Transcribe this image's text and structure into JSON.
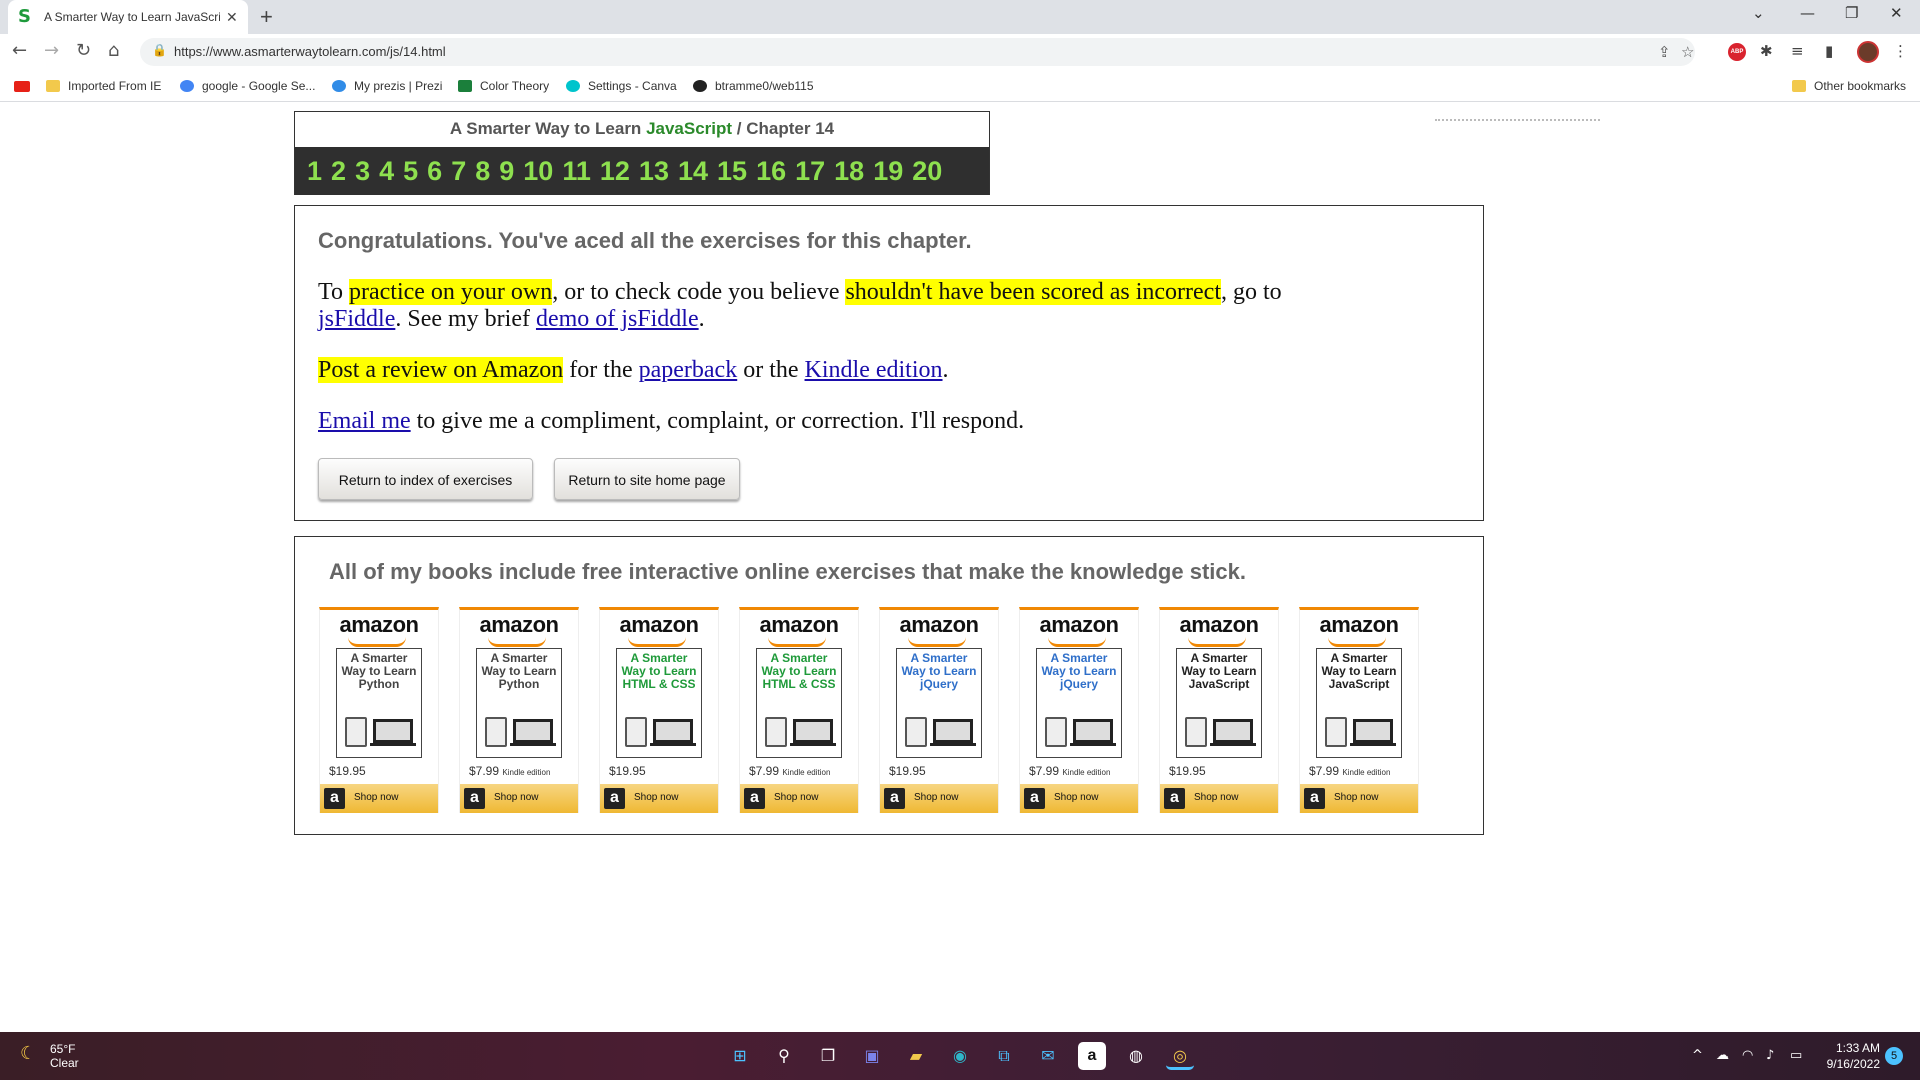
{
  "browser": {
    "tab_title": "A Smarter Way to Learn JavaScript",
    "tab_close": "✕",
    "new_tab": "+",
    "url": "https://www.asmarterwaytolearn.com/js/14.html",
    "bookmarks": [
      {
        "label": "Imported From IE",
        "icon_color": "#f2c94c"
      },
      {
        "label": "google - Google Se...",
        "icon_color": "#4285f4"
      },
      {
        "label": "My prezis | Prezi",
        "icon_color": "#318ce7"
      },
      {
        "label": "Color Theory",
        "icon_color": "#1b7f3b"
      },
      {
        "label": "Settings - Canva",
        "icon_color": "#00c4cc"
      },
      {
        "label": "btramme0/web115",
        "icon_color": "#222222"
      }
    ],
    "other_bookmarks": "Other bookmarks"
  },
  "chapter": {
    "title_prefix": "A Smarter Way to Learn",
    "title_js": "JavaScript",
    "title_sep": "/",
    "title_chapter": "Chapter 14",
    "numbers": [
      "1",
      "2",
      "3",
      "4",
      "5",
      "6",
      "7",
      "8",
      "9",
      "10",
      "11",
      "12",
      "13",
      "14",
      "15",
      "16",
      "17",
      "18",
      "19",
      "20"
    ]
  },
  "main": {
    "congrats": "Congratulations. You've aced all the exercises for this chapter.",
    "p1": {
      "t1": "To ",
      "h1": "practice on your own",
      "t2": ", or to check code you believe ",
      "h2": "shouldn't have been scored as incorrect",
      "t3": ", go to",
      "link1": "jsFiddle",
      "t4": ". See my brief ",
      "link2": "demo of jsFiddle",
      "t5": "."
    },
    "p2": {
      "h1": "Post a review on Amazon",
      "t1": " for the ",
      "link1": "paperback",
      "t2": " or the ",
      "link2": "Kindle edition",
      "t3": "."
    },
    "p3": {
      "link1": "Email me",
      "t1": " to give me a compliment, complaint, or correction. I'll respond."
    },
    "btn_index": "Return to index of exercises",
    "btn_home": "Return to site home page"
  },
  "books": {
    "heading": "All of my books include free interactive online exercises that make the knowledge stick.",
    "items": [
      {
        "logo": "amazon",
        "cover": "A Smarter Way to Learn Python",
        "cover_color": "#444444",
        "price": "$19.95",
        "kind": "",
        "shop": "Shop now"
      },
      {
        "logo": "amazon",
        "cover": "A Smarter Way to Learn Python",
        "cover_color": "#444444",
        "price": "$7.99",
        "kind": "Kindle edition",
        "shop": "Shop now"
      },
      {
        "logo": "amazon",
        "cover": "A Smarter Way to Learn HTML & CSS",
        "cover_color": "#1f9a3a",
        "price": "$19.95",
        "kind": "",
        "shop": "Shop now"
      },
      {
        "logo": "amazon",
        "cover": "A Smarter Way to Learn HTML & CSS",
        "cover_color": "#1f9a3a",
        "price": "$7.99",
        "kind": "Kindle edition",
        "shop": "Shop now"
      },
      {
        "logo": "amazon",
        "cover": "A Smarter Way to Learn jQuery",
        "cover_color": "#2f6fc9",
        "price": "$19.95",
        "kind": "",
        "shop": "Shop now"
      },
      {
        "logo": "amazon",
        "cover": "A Smarter Way to Learn jQuery",
        "cover_color": "#2f6fc9",
        "price": "$7.99",
        "kind": "Kindle edition",
        "shop": "Shop now"
      },
      {
        "logo": "amazon",
        "cover": "A Smarter Way to Learn JavaScript",
        "cover_color": "#222222",
        "price": "$19.95",
        "kind": "",
        "shop": "Shop now"
      },
      {
        "logo": "amazon",
        "cover": "A Smarter Way to Learn JavaScript",
        "cover_color": "#222222",
        "price": "$7.99",
        "kind": "Kindle edition",
        "shop": "Shop now"
      }
    ]
  },
  "taskbar": {
    "temp": "65°F",
    "condition": "Clear",
    "time": "1:33 AM",
    "date": "9/16/2022",
    "notifications": "5"
  }
}
